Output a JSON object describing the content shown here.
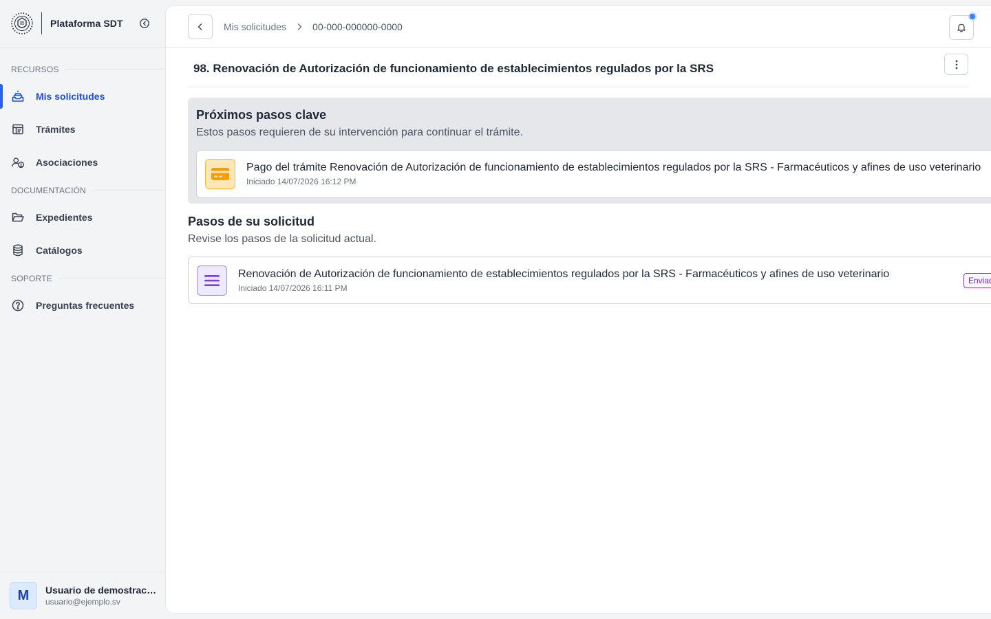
{
  "app": {
    "name": "Plataforma SDT"
  },
  "sidebar": {
    "sections": [
      {
        "title": "RECURSOS",
        "items": [
          {
            "label": "Mis solicitudes",
            "icon": "inbox-tray-icon",
            "active": true
          },
          {
            "label": "Trámites",
            "icon": "table-icon",
            "active": false
          },
          {
            "label": "Asociaciones",
            "icon": "user-group-icon",
            "active": false
          }
        ]
      },
      {
        "title": "DOCUMENTACIÓN",
        "items": [
          {
            "label": "Expedientes",
            "icon": "folder-open-icon",
            "active": false
          },
          {
            "label": "Catálogos",
            "icon": "database-icon",
            "active": false
          }
        ]
      },
      {
        "title": "SOPORTE",
        "items": [
          {
            "label": "Preguntas frecuentes",
            "icon": "question-circle-icon",
            "active": false
          }
        ]
      }
    ]
  },
  "user": {
    "initial": "M",
    "name": "Usuario de demostración",
    "email": "usuario@ejemplo.sv"
  },
  "header": {
    "breadcrumb": {
      "parent": "Mis solicitudes",
      "current": "00-000-000000-0000"
    },
    "notifications_unread": true
  },
  "page": {
    "title": "98. Renovación de Autorización de funcionamiento de establecimientos regulados por la SRS"
  },
  "next_steps": {
    "title": "Próximos pasos clave",
    "subtitle": "Estos pasos requieren de su intervención para continuar el trámite.",
    "items": [
      {
        "title": "Pago del trámite Renovación de Autorización de funcionamiento de establecimientos regulados por la SRS - Farmacéuticos y afines de uso veterinario",
        "date": "Iniciado 14/07/2026 16:12 PM",
        "icon": "credit-card-icon"
      }
    ]
  },
  "steps": {
    "title": "Pasos de su solicitud",
    "subtitle": "Revise los pasos de la solicitud actual.",
    "items": [
      {
        "title": "Renovación de Autorización de funcionamiento de establecimientos regulados por la SRS - Farmacéuticos y afines de uso veterinario",
        "date": "Iniciado 14/07/2026 16:11 PM",
        "status": "Enviado",
        "icon": "document-lines-icon"
      }
    ]
  },
  "colors": {
    "accent": "#2563eb",
    "payment_icon_bg": "#fde7b8",
    "payment_icon_fg": "#f59e0b",
    "document_icon_bg": "#ede9fe",
    "document_icon_fg": "#7c3aed",
    "notification_dot": "#3b82f6"
  }
}
